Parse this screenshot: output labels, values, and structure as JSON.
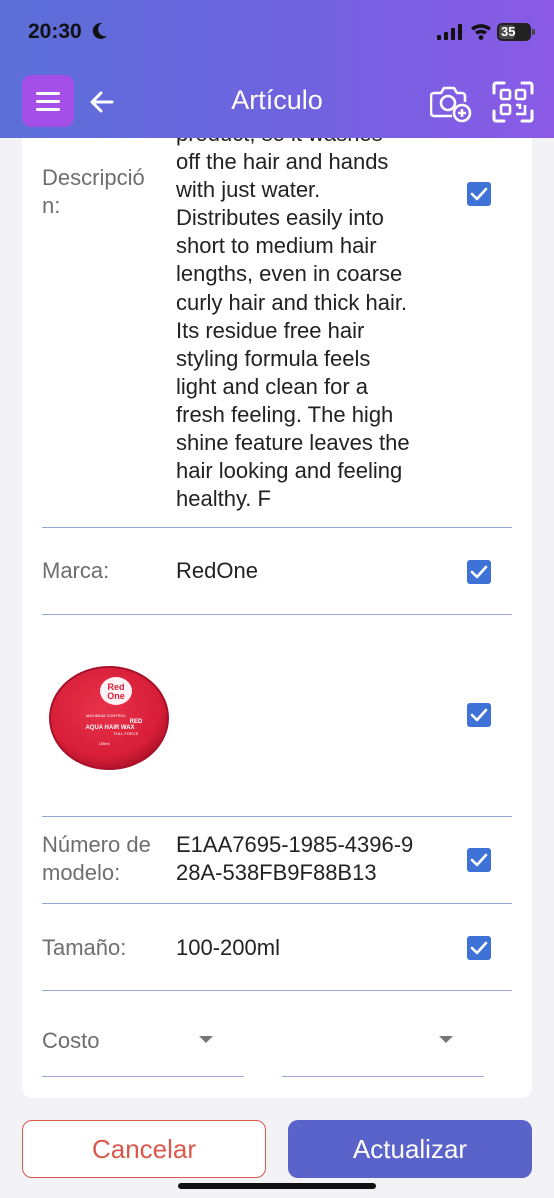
{
  "status_bar": {
    "time": "20:30",
    "battery": "35"
  },
  "header": {
    "title": "Artículo"
  },
  "form": {
    "description": {
      "label": "Descripció\nn:",
      "value": "product, so it washes\noff the hair and hands\nwith just water.\nDistributes easily into\nshort to medium hair\nlengths, even in coarse\ncurly hair and thick hair.\nIts residue free hair\nstyling formula feels\nlight and clean for a\nfresh feeling. The high\nshine feature leaves the\nhair looking and feeling\nhealthy. F",
      "checked": true
    },
    "brand": {
      "label": "Marca:",
      "value": "RedOne",
      "checked": true
    },
    "image": {
      "product_text_brand": "Red One",
      "product_text_line1": "MAXIMUM CONTROL",
      "product_text_line2": "RED",
      "product_text_line3": "AQUA HAIR WAX",
      "product_text_line4": "FULL FORCE",
      "product_text_line5": "150ml",
      "checked": true
    },
    "model_number": {
      "label": "Número de\nmodelo:",
      "value": "E1AA7695-1985-4396-9\n28A-538FB9F88B13",
      "checked": true
    },
    "size": {
      "label": "Tamaño:",
      "value": "100-200ml",
      "checked": true
    },
    "cost": {
      "label": "Costo"
    }
  },
  "actions": {
    "cancel_label": "Cancelar",
    "update_label": "Actualizar"
  },
  "colors": {
    "accent": "#5a63c9",
    "menu_button": "#a450e8",
    "checkbox": "#3f72d6",
    "cancel": "#d9594c"
  },
  "icons": [
    "menu-icon",
    "back-arrow-icon",
    "camera-add-icon",
    "scan-icon",
    "checkbox-icon",
    "dropdown-caret-icon"
  ]
}
